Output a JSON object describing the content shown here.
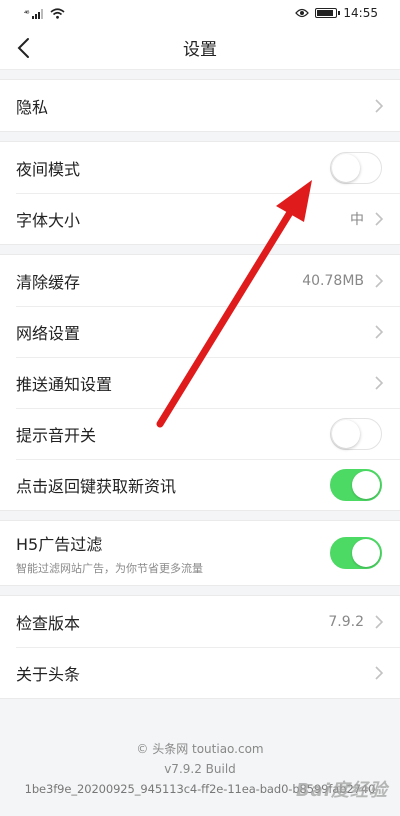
{
  "status_bar": {
    "signal": "⁴⁶",
    "time": "14:55"
  },
  "nav": {
    "title": "设置"
  },
  "groups": [
    {
      "rows": [
        {
          "label": "隐私"
        }
      ]
    },
    {
      "rows": [
        {
          "label": "夜间模式",
          "toggle": false
        },
        {
          "label": "字体大小",
          "value": "中"
        }
      ]
    },
    {
      "rows": [
        {
          "label": "清除缓存",
          "value": "40.78MB"
        },
        {
          "label": "网络设置"
        },
        {
          "label": "推送通知设置"
        },
        {
          "label": "提示音开关",
          "toggle": false
        },
        {
          "label": "点击返回键获取新资讯",
          "toggle": true
        }
      ]
    },
    {
      "rows": [
        {
          "label": "H5广告过滤",
          "sub": "智能过滤网站广告，为你节省更多流量",
          "toggle": true
        }
      ]
    },
    {
      "rows": [
        {
          "label": "检查版本",
          "value": "7.9.2"
        },
        {
          "label": "关于头条"
        }
      ]
    }
  ],
  "footer": {
    "copyright": "© 头条网 toutiao.com",
    "version": "v7.9.2 Build",
    "build_id": "1be3f9e_20200925_945113c4-ff2e-11ea-bad0-b8599fab2740"
  },
  "watermark": "Bai度经验",
  "colors": {
    "toggle_on": "#4cd964",
    "arrow": "#e01b1b"
  }
}
